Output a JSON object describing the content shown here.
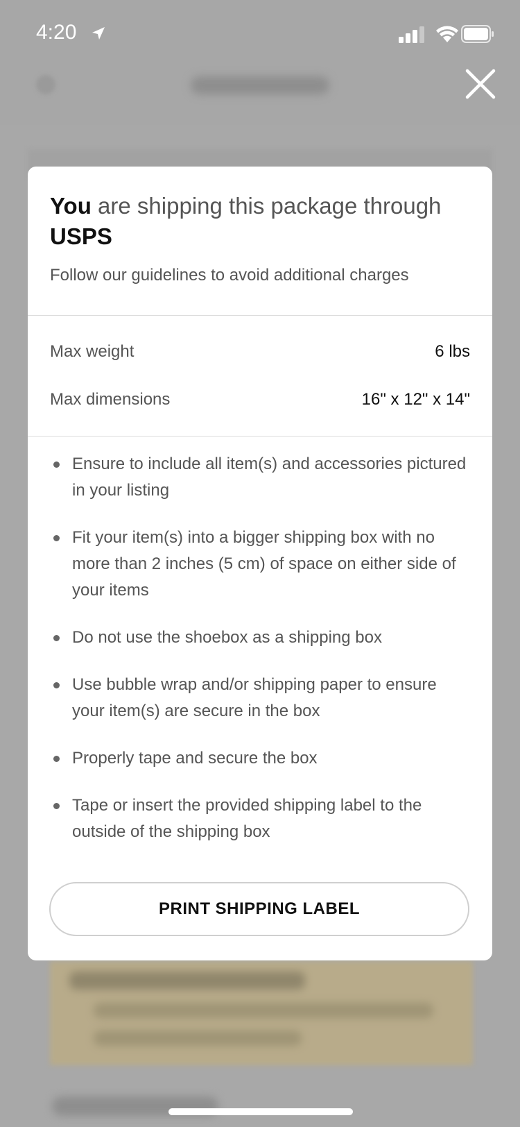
{
  "status_bar": {
    "time": "4:20"
  },
  "modal": {
    "title_strong_1": "You",
    "title_text_1": " are shipping this package through ",
    "title_strong_2": "USPS",
    "subtitle": "Follow our guidelines to avoid additional charges",
    "specs": [
      {
        "label": "Max weight",
        "value": "6 lbs"
      },
      {
        "label": "Max dimensions",
        "value": "16\" x 12\" x 14\""
      }
    ],
    "guidelines": [
      "Ensure to include all item(s) and accessories pictured in your listing",
      "Fit your item(s) into a bigger shipping box with no more than 2 inches (5 cm) of space on either side of your items",
      "Do not use the shoebox as a shipping box",
      "Use bubble wrap and/or shipping paper to ensure your item(s) are secure in the box",
      "Properly tape and secure the box",
      "Tape or insert the provided shipping label to the outside of the shipping box"
    ],
    "print_button_label": "PRINT SHIPPING LABEL"
  },
  "icons": {
    "close": "close-icon",
    "location": "location-arrow-icon",
    "signal": "cellular-signal-icon",
    "wifi": "wifi-icon",
    "battery": "battery-icon"
  },
  "colors": {
    "overlay": "#a8a8a8",
    "modal_bg": "#ffffff",
    "text_primary": "#111111",
    "text_secondary": "#555555",
    "divider": "#dcdcdc"
  }
}
